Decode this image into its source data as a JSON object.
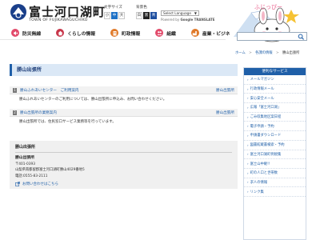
{
  "header": {
    "logo_title": "富士河口湖町",
    "logo_subtitle": "TOWN OF FUJIKAWAGUCHIKO",
    "fontsize_label": "文字サイズ",
    "fontsize_options": [
      "小",
      "中",
      "大"
    ],
    "bgcolor_label": "背景色",
    "bgcolor_options": [
      "白",
      "黒",
      "青"
    ],
    "language_select": "Select Language",
    "translate_powered": "Powered by",
    "translate_brand": "Google TRANSLATE",
    "mascot_label": "ふじっぴー"
  },
  "nav": {
    "items": [
      {
        "label": "防災無線",
        "icon": "megaphone-icon",
        "color": "#e24b6b"
      },
      {
        "label": "くらしの情報",
        "icon": "house-icon",
        "color": "#c8364a"
      },
      {
        "label": "町政情報",
        "icon": "building-icon",
        "color": "#e07a2a"
      },
      {
        "label": "組織",
        "icon": "people-icon",
        "color": "#e24b6b"
      },
      {
        "label": "産業・ビジネ",
        "icon": "factory-icon",
        "color": "#e07a2a"
      }
    ]
  },
  "search": {
    "placeholder": ""
  },
  "breadcrumb": {
    "items": [
      "ホーム",
      "各課の情報",
      "勝山出張所"
    ]
  },
  "main": {
    "title": "勝山出張所",
    "sections": [
      {
        "num": "1",
        "title": "勝山ふれあいセンター　ご利用案内",
        "dept": "勝山出張所",
        "body": "勝山ふれあいセンターのご利用については、勝山出張所に申込み、お問い合わせください。"
      },
      {
        "num": "2",
        "title": "勝山出張所の業務案内",
        "dept": "勝山出張所",
        "body": "勝山出張所では、住民窓口サービス業務等を行っています。"
      }
    ],
    "contact": {
      "heading": "勝山出張所",
      "name": "勝山出張所",
      "postal": "〒401-0393",
      "address": "山梨県南都留郡富士河口湖町勝山4029番地5",
      "phone": "電話:0555-83-2111",
      "link": "お問い合わせはこちら"
    }
  },
  "sidebar": {
    "heading": "便利なサービス",
    "items": [
      "メールマガジン",
      "行政情報メール",
      "安心安全メール",
      "広報「富士河口湖」",
      "ごみ収集地区案日程",
      "電子申請・予約",
      "申請書ダウンロード",
      "図書館蔵書検索・予約",
      "富士河口湖町例規集",
      "富士山中継!!",
      "町の人口と世帯数",
      "求人の情報",
      "リンク集"
    ]
  },
  "colors": {
    "primary_blue": "#1f5fa8",
    "title_bar_bg": "#dbe8f6",
    "contact_bg": "#f0f0f0"
  }
}
